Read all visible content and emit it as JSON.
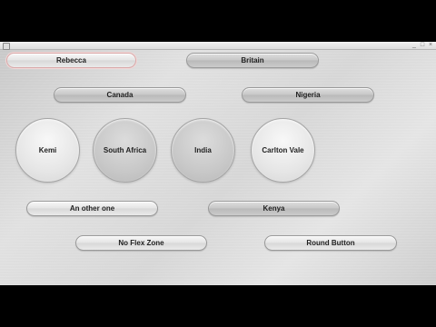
{
  "window": {
    "controls": {
      "minimize": "_",
      "maximize": "□",
      "close": "×"
    }
  },
  "buttons": {
    "rebecca": "Rebecca",
    "britain": "Britain",
    "canada": "Canada",
    "nigeria": "Nigeria",
    "kemi": "Kemi",
    "south_africa": "South Africa",
    "india": "India",
    "carlton_vale": "Carlton Vale",
    "another_one": "An other one",
    "kenya": "Kenya",
    "no_flex_zone": "No Flex Zone",
    "round_button": "Round Button"
  }
}
